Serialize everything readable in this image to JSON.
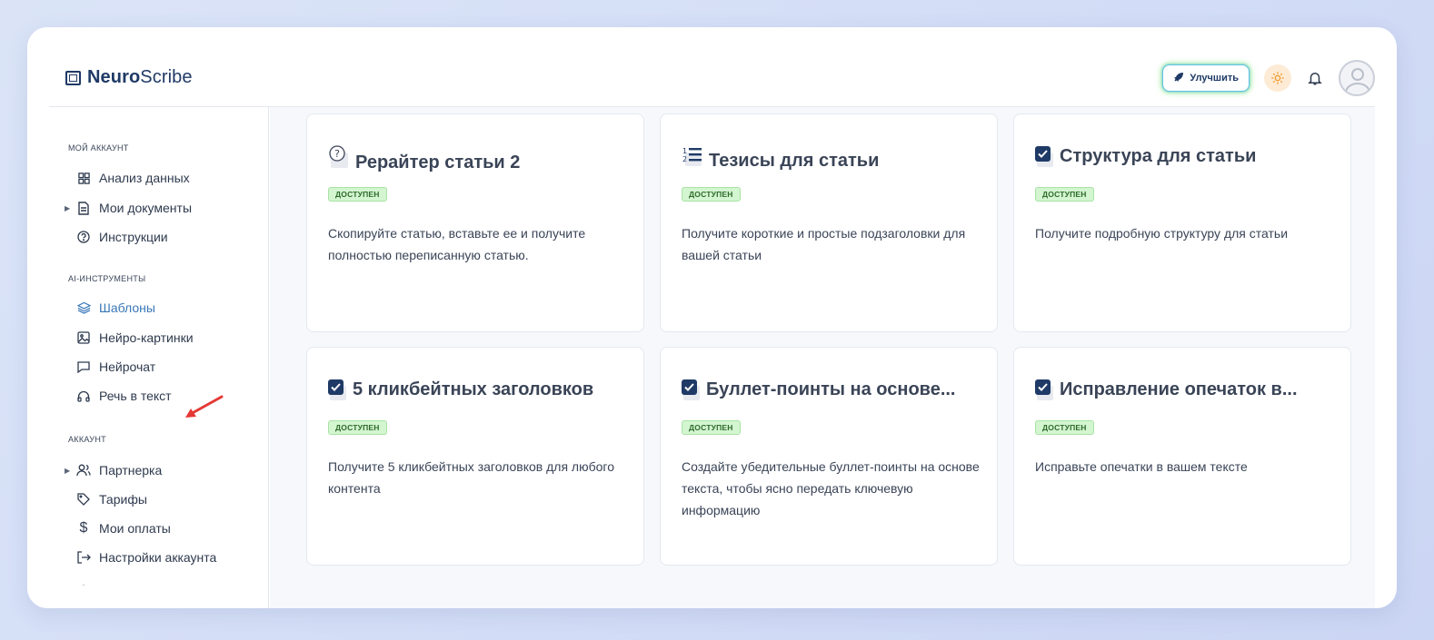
{
  "app": {
    "logo_bold": "Neuro",
    "logo_light": "Scribe"
  },
  "header": {
    "upgrade_label": "Улучшить"
  },
  "sidebar": {
    "sections": [
      {
        "title": "Мой аккаунт",
        "items": [
          {
            "label": "Анализ данных",
            "icon": "grid-icon"
          },
          {
            "label": "Мои документы",
            "icon": "document-icon",
            "expandable": true
          },
          {
            "label": "Инструкции",
            "icon": "help-circle-icon"
          }
        ]
      },
      {
        "title": "AI-инструменты",
        "items": [
          {
            "label": "Шаблоны",
            "icon": "layers-icon",
            "active": true
          },
          {
            "label": "Нейро-картинки",
            "icon": "image-icon"
          },
          {
            "label": "Нейрочат",
            "icon": "chat-icon"
          },
          {
            "label": "Речь в текст",
            "icon": "headphones-icon"
          }
        ]
      },
      {
        "title": "Аккаунт",
        "items": [
          {
            "label": "Партнерка",
            "icon": "users-icon",
            "expandable": true
          },
          {
            "label": "Тарифы",
            "icon": "tag-icon"
          },
          {
            "label": "Мои оплаты",
            "icon": "dollar-icon"
          },
          {
            "label": "Настройки аккаунта",
            "icon": "logout-icon"
          }
        ]
      }
    ]
  },
  "cards": [
    {
      "title": "Рерайтер статьи 2",
      "badge": "Доступен",
      "icon": "question-doc-icon",
      "description": "Скопируйте статью, вставьте ее и получите полностью переписанную статью."
    },
    {
      "title": "Тезисы для статьи",
      "badge": "Доступен",
      "icon": "list-icon",
      "description": "Получите короткие и простые подзаголовки для вашей статьи"
    },
    {
      "title": "Структура для статьи",
      "badge": "Доступен",
      "icon": "checkbox-icon",
      "description": "Получите подробную структуру для статьи"
    },
    {
      "title": "5 кликбейтных заголовков",
      "badge": "Доступен",
      "icon": "checkbox-icon",
      "description": "Получите 5 кликбейтных заголовков для любого контента"
    },
    {
      "title": "Буллет-поинты на основе...",
      "badge": "Доступен",
      "icon": "checkbox-icon",
      "description": "Создайте убедительные буллет-поинты на основе текста, чтобы ясно передать ключевую информацию"
    },
    {
      "title": "Исправление опечаток в...",
      "badge": "Доступен",
      "icon": "checkbox-icon",
      "description": "Исправьте опечатки в вашем тексте"
    }
  ],
  "colors": {
    "accent": "#3978b8",
    "brand": "#1f3a66",
    "badge_bg": "#d3f5d0",
    "annotation_arrow": "#e53935"
  }
}
